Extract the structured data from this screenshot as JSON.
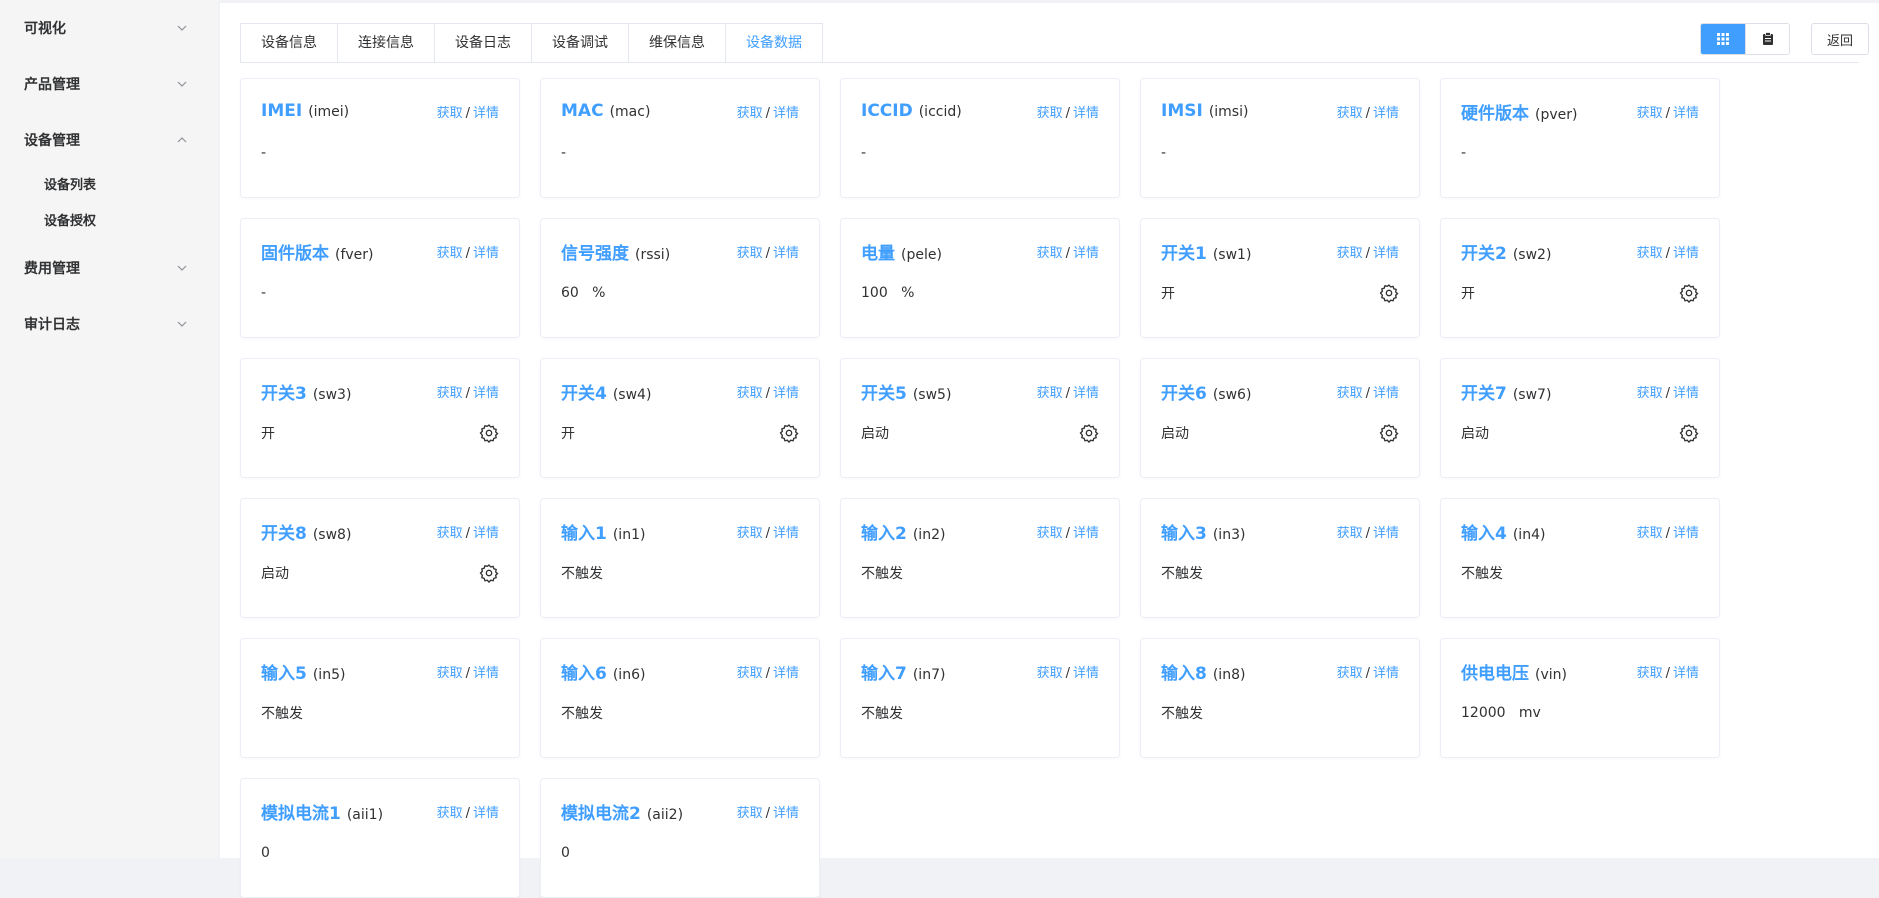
{
  "sidebar": {
    "menus": [
      {
        "label": "可视化",
        "expanded": false,
        "children": []
      },
      {
        "label": "产品管理",
        "expanded": false,
        "children": []
      },
      {
        "label": "设备管理",
        "expanded": true,
        "children": [
          "设备列表",
          "设备授权"
        ]
      },
      {
        "label": "费用管理",
        "expanded": false,
        "children": []
      },
      {
        "label": "审计日志",
        "expanded": false,
        "children": []
      }
    ]
  },
  "tabs": [
    {
      "label": "设备信息",
      "active": false
    },
    {
      "label": "连接信息",
      "active": false
    },
    {
      "label": "设备日志",
      "active": false
    },
    {
      "label": "设备调试",
      "active": false
    },
    {
      "label": "维保信息",
      "active": false
    },
    {
      "label": "设备数据",
      "active": true
    }
  ],
  "toolbar": {
    "view_mode": "grid",
    "grid_icon": "grid-icon",
    "list_icon": "clipboard-icon",
    "back_label": "返回"
  },
  "card_actions": {
    "fetch": "获取",
    "separator": "/",
    "detail": "详情"
  },
  "cards": [
    {
      "name": "IMEI",
      "key": "(imei)",
      "value": "-",
      "settings": false
    },
    {
      "name": "MAC",
      "key": "(mac)",
      "value": "-",
      "settings": false
    },
    {
      "name": "ICCID",
      "key": "(iccid)",
      "value": "-",
      "settings": false
    },
    {
      "name": "IMSI",
      "key": "(imsi)",
      "value": "-",
      "settings": false
    },
    {
      "name": "硬件版本",
      "key": "(pver)",
      "value": "-",
      "settings": false
    },
    {
      "name": "固件版本",
      "key": "(fver)",
      "value": "-",
      "settings": false
    },
    {
      "name": "信号强度",
      "key": "(rssi)",
      "value": "60   %",
      "settings": false
    },
    {
      "name": "电量",
      "key": "(pele)",
      "value": "100   %",
      "settings": false
    },
    {
      "name": "开关1",
      "key": "(sw1)",
      "value": "开",
      "settings": true
    },
    {
      "name": "开关2",
      "key": "(sw2)",
      "value": "开",
      "settings": true
    },
    {
      "name": "开关3",
      "key": "(sw3)",
      "value": "开",
      "settings": true
    },
    {
      "name": "开关4",
      "key": "(sw4)",
      "value": "开",
      "settings": true
    },
    {
      "name": "开关5",
      "key": "(sw5)",
      "value": "启动",
      "settings": true
    },
    {
      "name": "开关6",
      "key": "(sw6)",
      "value": "启动",
      "settings": true
    },
    {
      "name": "开关7",
      "key": "(sw7)",
      "value": "启动",
      "settings": true
    },
    {
      "name": "开关8",
      "key": "(sw8)",
      "value": "启动",
      "settings": true
    },
    {
      "name": "输入1",
      "key": "(in1)",
      "value": "不触发",
      "settings": false
    },
    {
      "name": "输入2",
      "key": "(in2)",
      "value": "不触发",
      "settings": false
    },
    {
      "name": "输入3",
      "key": "(in3)",
      "value": "不触发",
      "settings": false
    },
    {
      "name": "输入4",
      "key": "(in4)",
      "value": "不触发",
      "settings": false
    },
    {
      "name": "输入5",
      "key": "(in5)",
      "value": "不触发",
      "settings": false
    },
    {
      "name": "输入6",
      "key": "(in6)",
      "value": "不触发",
      "settings": false
    },
    {
      "name": "输入7",
      "key": "(in7)",
      "value": "不触发",
      "settings": false
    },
    {
      "name": "输入8",
      "key": "(in8)",
      "value": "不触发",
      "settings": false
    },
    {
      "name": "供电电压",
      "key": "(vin)",
      "value": "12000   mv",
      "settings": false
    },
    {
      "name": "模拟电流1",
      "key": "(aii1)",
      "value": "0",
      "settings": false
    },
    {
      "name": "模拟电流2",
      "key": "(aii2)",
      "value": "0",
      "settings": false
    }
  ],
  "colors": {
    "accent": "#409eff",
    "text": "#303133",
    "border": "#ebeef5",
    "sidebar_bg": "#f5f5f5"
  }
}
